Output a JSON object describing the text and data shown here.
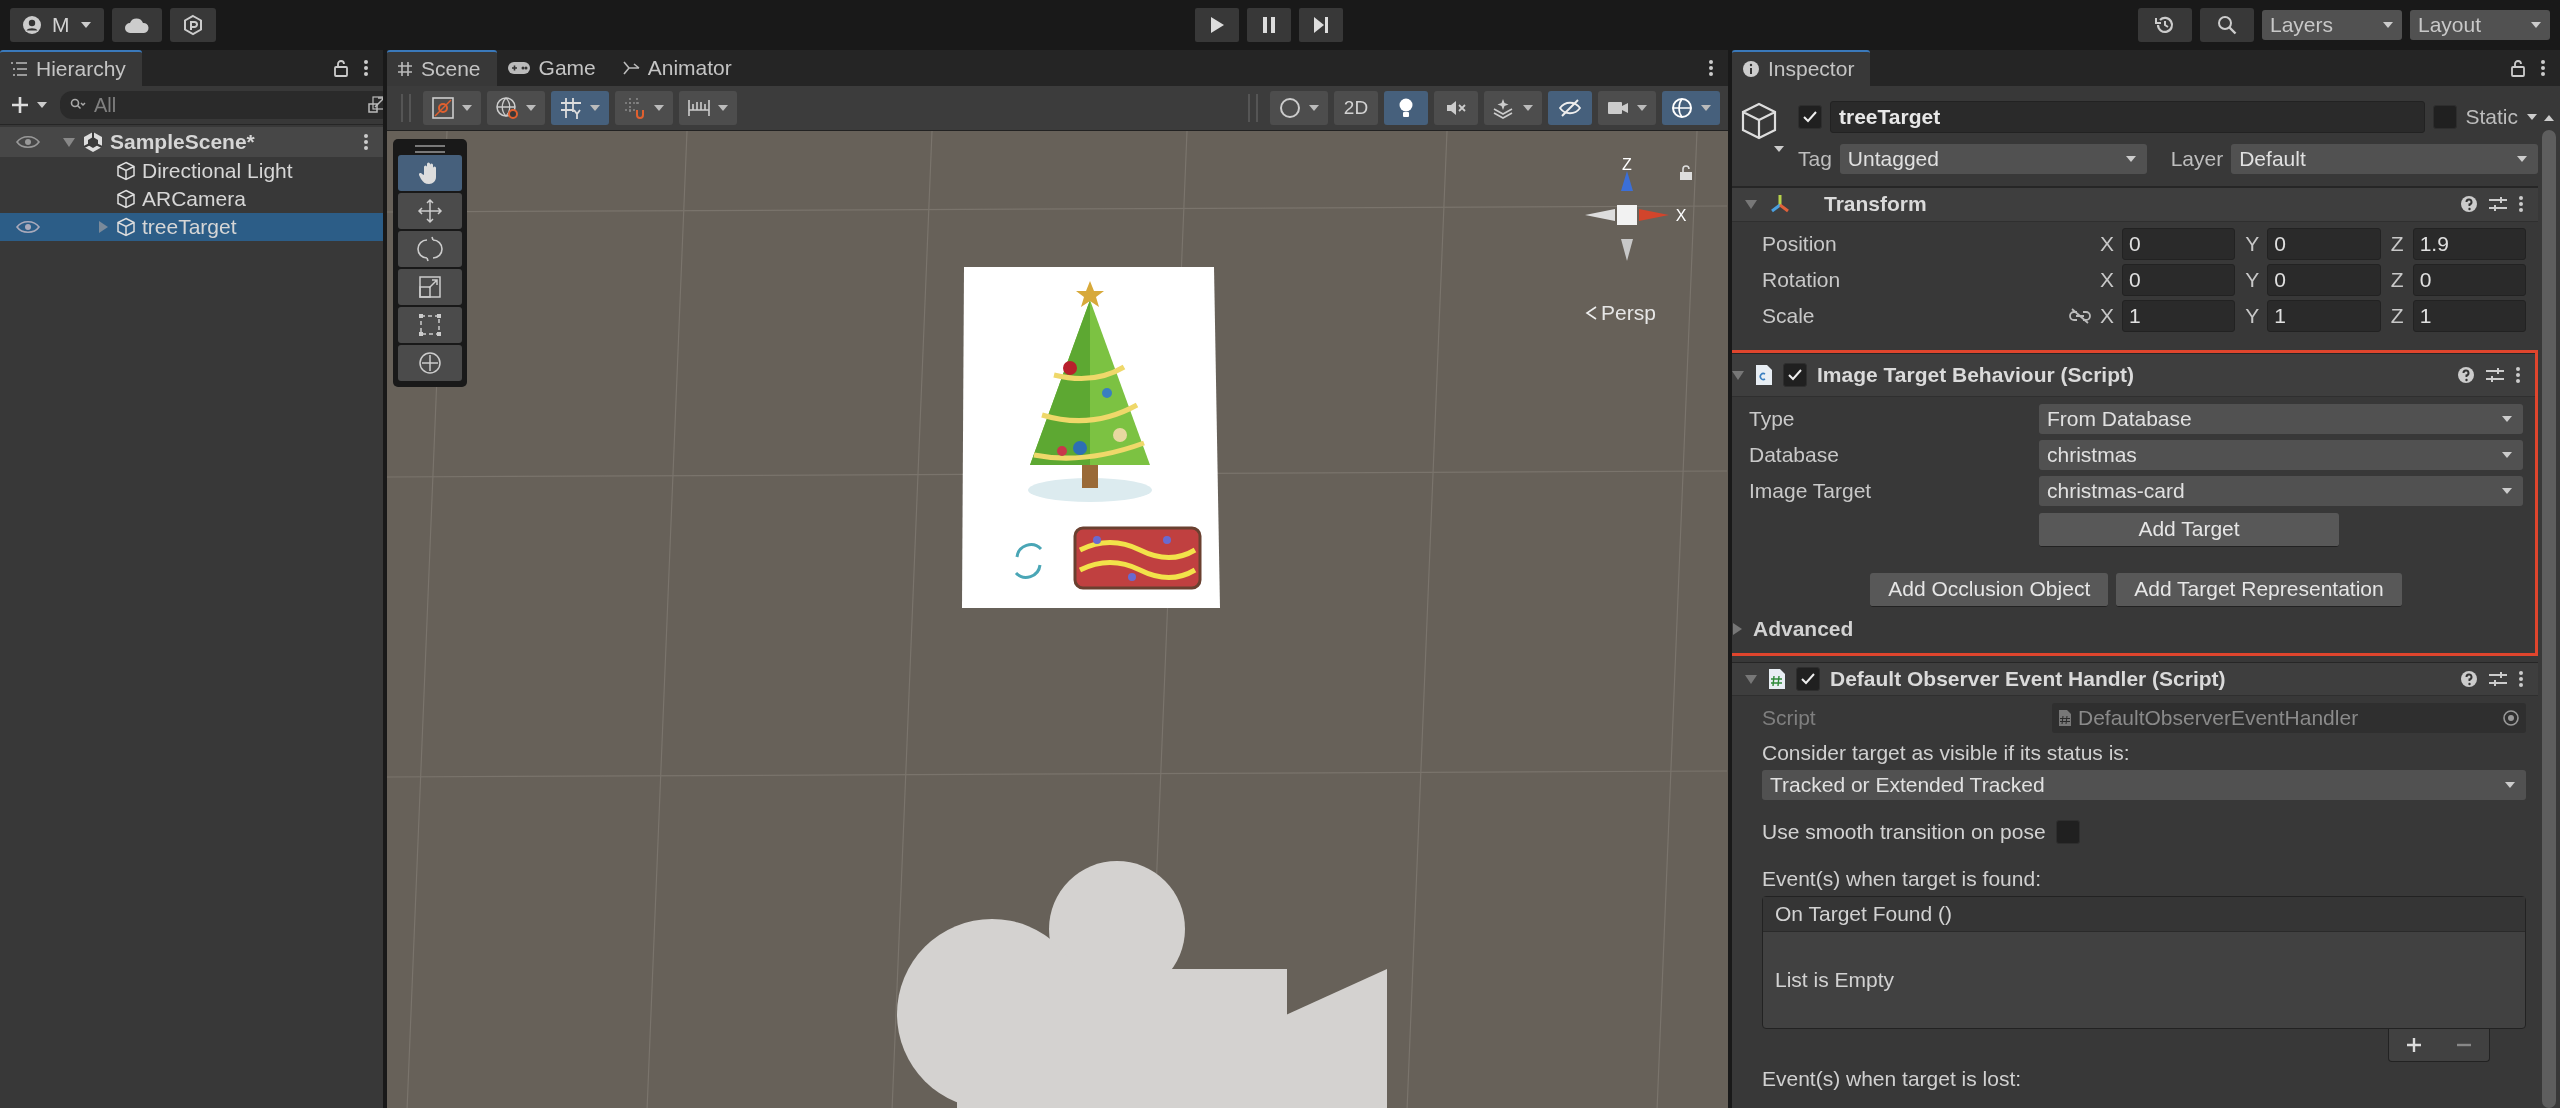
{
  "toolbar": {
    "account": "M",
    "layers": "Layers",
    "layout": "Layout"
  },
  "hierarchy": {
    "title": "Hierarchy",
    "search": {
      "placeholder": "All"
    },
    "tree": [
      {
        "label": "SampleScene*",
        "expanded": true,
        "children": [
          {
            "label": "Directional Light",
            "selected": false
          },
          {
            "label": "ARCamera",
            "selected": false
          },
          {
            "label": "treeTarget",
            "selected": true,
            "expanded": false
          }
        ]
      }
    ]
  },
  "scene_view": {
    "tabs": [
      {
        "label": "Scene",
        "kind": "scene",
        "selected": true
      },
      {
        "label": "Game",
        "kind": "game",
        "selected": false
      },
      {
        "label": "Animator",
        "kind": "animator",
        "selected": false
      }
    ],
    "left_tools": [
      {
        "kind": "drawmode",
        "selected": false
      },
      {
        "kind": "globe",
        "selected": false
      },
      {
        "kind": "grid",
        "selected": true
      },
      {
        "kind": "snap",
        "selected": false
      },
      {
        "kind": "ruler",
        "selected": false
      }
    ],
    "right_tools": [
      {
        "kind": "shading",
        "selected": false
      },
      {
        "kind": "dimension",
        "label": "2D",
        "selected": false
      },
      {
        "kind": "light",
        "selected": true
      },
      {
        "kind": "audio",
        "selected": false
      },
      {
        "kind": "effects",
        "selected": false
      },
      {
        "kind": "visibility",
        "selected": true
      },
      {
        "kind": "camera",
        "selected": false
      },
      {
        "kind": "gizmos",
        "selected": true
      }
    ],
    "palette": [
      {
        "kind": "hand",
        "selected": true
      },
      {
        "kind": "move",
        "selected": false
      },
      {
        "kind": "rotate",
        "selected": false
      },
      {
        "kind": "scale",
        "selected": false
      },
      {
        "kind": "rect",
        "selected": false
      },
      {
        "kind": "transform",
        "selected": false
      }
    ],
    "axes": [
      "Z",
      "X"
    ],
    "projection": "Persp"
  },
  "inspector": {
    "title": "Inspector",
    "object": {
      "active": true,
      "name": "treeTarget",
      "static": false,
      "static_label": "Static",
      "tag_label": "Tag",
      "tag": "Untagged",
      "layer_label": "Layer",
      "layer": "Default"
    },
    "transform": {
      "title": "Transform",
      "expanded": true,
      "rows": [
        {
          "label": "Position",
          "values": [
            {
              "axis": "X",
              "value": "0"
            },
            {
              "axis": "Y",
              "value": "0"
            },
            {
              "axis": "Z",
              "value": "1.9"
            }
          ]
        },
        {
          "label": "Rotation",
          "values": [
            {
              "axis": "X",
              "value": "0"
            },
            {
              "axis": "Y",
              "value": "0"
            },
            {
              "axis": "Z",
              "value": "0"
            }
          ]
        },
        {
          "label": "Scale",
          "values": [
            {
              "axis": "X",
              "value": "1"
            },
            {
              "axis": "Y",
              "value": "1"
            },
            {
              "axis": "Z",
              "value": "1"
            }
          ]
        }
      ]
    },
    "image_target": {
      "title": "Image Target Behaviour (Script)",
      "enabled": true,
      "expanded": true,
      "highlighted": true,
      "fields": [
        {
          "label": "Type",
          "value": "From Database"
        },
        {
          "label": "Database",
          "value": "christmas"
        },
        {
          "label": "Image Target",
          "value": "christmas-card"
        }
      ],
      "add_target": "Add Target",
      "buttons": [
        "Add Occlusion Object",
        "Add Target Representation"
      ],
      "advanced": {
        "label": "Advanced",
        "expanded": false
      }
    },
    "observer": {
      "title": "Default Observer Event Handler (Script)",
      "enabled": true,
      "expanded": true,
      "script_label": "Script",
      "script": "DefaultObserverEventHandler",
      "status_label": "Consider target as visible if its status is:",
      "status": "Tracked or Extended Tracked",
      "smooth_label": "Use smooth transition on pose",
      "smooth": false,
      "found_label": "Event(s) when target is found:",
      "found_event": "On Target Found ()",
      "found_empty": "List is Empty",
      "lost_label": "Event(s) when target is lost:"
    }
  }
}
